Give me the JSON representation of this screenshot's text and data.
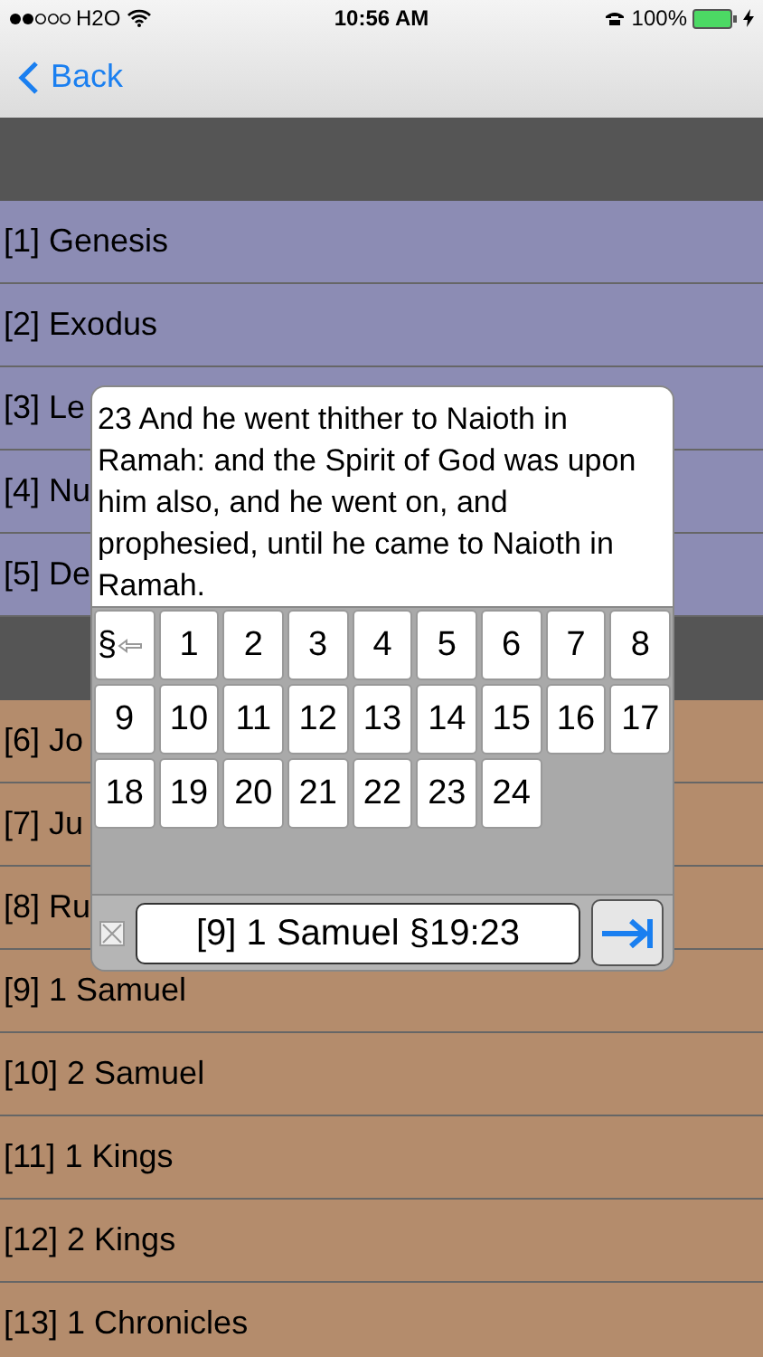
{
  "status_bar": {
    "carrier": "H2O",
    "time": "10:56 AM",
    "battery": "100%"
  },
  "nav": {
    "back": "Back"
  },
  "sections": [
    {
      "items": [
        "[1] Genesis",
        "[2] Exodus",
        "[3] Le",
        "[4] Nu",
        "[5] De"
      ],
      "color": "#8c8cb4"
    },
    {
      "items": [
        "[6] Jo",
        "[7] Ju",
        "[8] Ru",
        "[9] 1 Samuel",
        "[10] 2 Samuel",
        "[11] 1 Kings",
        "[12] 2 Kings",
        "[13] 1 Chronicles"
      ],
      "color": "#b48c6c"
    }
  ],
  "popup": {
    "verse": "23 And he went thither to Naioth in Ramah: and the Spirit of God was upon him also, and he went on, and prophesied, until he came to Naioth in Ramah.",
    "keys": [
      {
        "kind": "section-back",
        "label": "§"
      },
      {
        "kind": "number",
        "label": "1"
      },
      {
        "kind": "number",
        "label": "2"
      },
      {
        "kind": "number",
        "label": "3"
      },
      {
        "kind": "number",
        "label": "4"
      },
      {
        "kind": "number",
        "label": "5"
      },
      {
        "kind": "number",
        "label": "6"
      },
      {
        "kind": "number",
        "label": "7"
      },
      {
        "kind": "number",
        "label": "8"
      },
      {
        "kind": "number",
        "label": "9"
      },
      {
        "kind": "number",
        "label": "10"
      },
      {
        "kind": "number",
        "label": "11"
      },
      {
        "kind": "number",
        "label": "12"
      },
      {
        "kind": "number",
        "label": "13"
      },
      {
        "kind": "number",
        "label": "14"
      },
      {
        "kind": "number",
        "label": "15"
      },
      {
        "kind": "number",
        "label": "16"
      },
      {
        "kind": "number",
        "label": "17"
      },
      {
        "kind": "number",
        "label": "18"
      },
      {
        "kind": "number",
        "label": "19"
      },
      {
        "kind": "number",
        "label": "20"
      },
      {
        "kind": "number",
        "label": "21"
      },
      {
        "kind": "number",
        "label": "22"
      },
      {
        "kind": "number",
        "label": "23"
      },
      {
        "kind": "number",
        "label": "24"
      }
    ],
    "reference": "[9] 1 Samuel §19:23"
  }
}
